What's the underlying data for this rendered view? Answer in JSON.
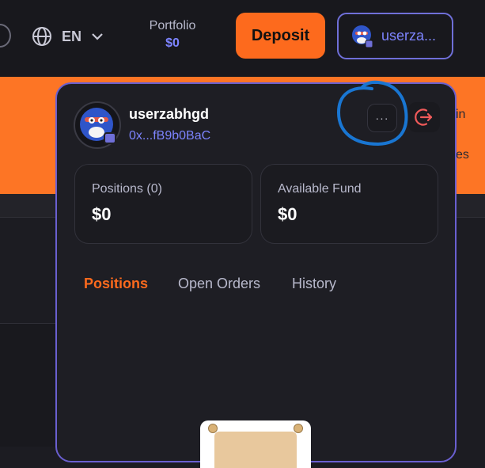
{
  "topbar": {
    "language": "EN",
    "portfolio_label": "Portfolio",
    "portfolio_value": "$0",
    "deposit_label": "Deposit",
    "user_button_label": "userza..."
  },
  "background": {
    "band_text_1": "in",
    "band_text_2": "es"
  },
  "panel": {
    "username": "userzabhgd",
    "address": "0x...fB9b0BaC",
    "more_label": "···",
    "cards": [
      {
        "label": "Positions (0)",
        "value": "$0"
      },
      {
        "label": "Available Fund",
        "value": "$0"
      }
    ],
    "tabs": [
      {
        "label": "Positions",
        "active": true
      },
      {
        "label": "Open Orders",
        "active": false
      },
      {
        "label": "History",
        "active": false
      }
    ]
  },
  "colors": {
    "accent_orange": "#fd6a1d",
    "accent_purple": "#7d84ff",
    "annotation_blue": "#1976d2",
    "logout_red": "#f05a5a"
  }
}
